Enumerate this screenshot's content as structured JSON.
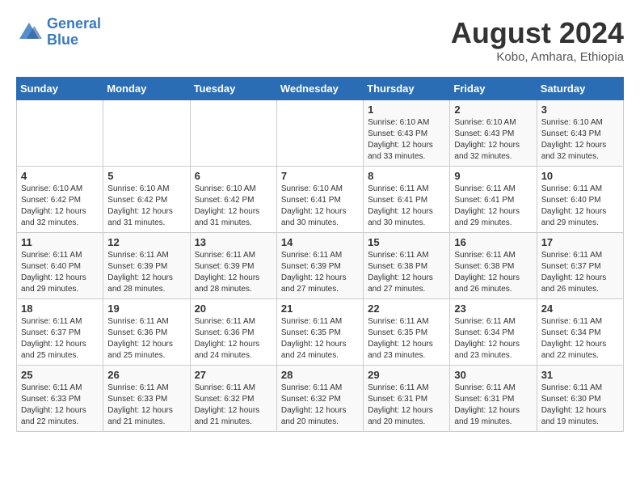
{
  "header": {
    "logo_line1": "General",
    "logo_line2": "Blue",
    "month": "August 2024",
    "location": "Kobo, Amhara, Ethiopia"
  },
  "days_of_week": [
    "Sunday",
    "Monday",
    "Tuesday",
    "Wednesday",
    "Thursday",
    "Friday",
    "Saturday"
  ],
  "weeks": [
    [
      {
        "day": "",
        "info": ""
      },
      {
        "day": "",
        "info": ""
      },
      {
        "day": "",
        "info": ""
      },
      {
        "day": "",
        "info": ""
      },
      {
        "day": "1",
        "info": "Sunrise: 6:10 AM\nSunset: 6:43 PM\nDaylight: 12 hours and 33 minutes."
      },
      {
        "day": "2",
        "info": "Sunrise: 6:10 AM\nSunset: 6:43 PM\nDaylight: 12 hours and 32 minutes."
      },
      {
        "day": "3",
        "info": "Sunrise: 6:10 AM\nSunset: 6:43 PM\nDaylight: 12 hours and 32 minutes."
      }
    ],
    [
      {
        "day": "4",
        "info": "Sunrise: 6:10 AM\nSunset: 6:42 PM\nDaylight: 12 hours and 32 minutes."
      },
      {
        "day": "5",
        "info": "Sunrise: 6:10 AM\nSunset: 6:42 PM\nDaylight: 12 hours and 31 minutes."
      },
      {
        "day": "6",
        "info": "Sunrise: 6:10 AM\nSunset: 6:42 PM\nDaylight: 12 hours and 31 minutes."
      },
      {
        "day": "7",
        "info": "Sunrise: 6:10 AM\nSunset: 6:41 PM\nDaylight: 12 hours and 30 minutes."
      },
      {
        "day": "8",
        "info": "Sunrise: 6:11 AM\nSunset: 6:41 PM\nDaylight: 12 hours and 30 minutes."
      },
      {
        "day": "9",
        "info": "Sunrise: 6:11 AM\nSunset: 6:41 PM\nDaylight: 12 hours and 29 minutes."
      },
      {
        "day": "10",
        "info": "Sunrise: 6:11 AM\nSunset: 6:40 PM\nDaylight: 12 hours and 29 minutes."
      }
    ],
    [
      {
        "day": "11",
        "info": "Sunrise: 6:11 AM\nSunset: 6:40 PM\nDaylight: 12 hours and 29 minutes."
      },
      {
        "day": "12",
        "info": "Sunrise: 6:11 AM\nSunset: 6:39 PM\nDaylight: 12 hours and 28 minutes."
      },
      {
        "day": "13",
        "info": "Sunrise: 6:11 AM\nSunset: 6:39 PM\nDaylight: 12 hours and 28 minutes."
      },
      {
        "day": "14",
        "info": "Sunrise: 6:11 AM\nSunset: 6:39 PM\nDaylight: 12 hours and 27 minutes."
      },
      {
        "day": "15",
        "info": "Sunrise: 6:11 AM\nSunset: 6:38 PM\nDaylight: 12 hours and 27 minutes."
      },
      {
        "day": "16",
        "info": "Sunrise: 6:11 AM\nSunset: 6:38 PM\nDaylight: 12 hours and 26 minutes."
      },
      {
        "day": "17",
        "info": "Sunrise: 6:11 AM\nSunset: 6:37 PM\nDaylight: 12 hours and 26 minutes."
      }
    ],
    [
      {
        "day": "18",
        "info": "Sunrise: 6:11 AM\nSunset: 6:37 PM\nDaylight: 12 hours and 25 minutes."
      },
      {
        "day": "19",
        "info": "Sunrise: 6:11 AM\nSunset: 6:36 PM\nDaylight: 12 hours and 25 minutes."
      },
      {
        "day": "20",
        "info": "Sunrise: 6:11 AM\nSunset: 6:36 PM\nDaylight: 12 hours and 24 minutes."
      },
      {
        "day": "21",
        "info": "Sunrise: 6:11 AM\nSunset: 6:35 PM\nDaylight: 12 hours and 24 minutes."
      },
      {
        "day": "22",
        "info": "Sunrise: 6:11 AM\nSunset: 6:35 PM\nDaylight: 12 hours and 23 minutes."
      },
      {
        "day": "23",
        "info": "Sunrise: 6:11 AM\nSunset: 6:34 PM\nDaylight: 12 hours and 23 minutes."
      },
      {
        "day": "24",
        "info": "Sunrise: 6:11 AM\nSunset: 6:34 PM\nDaylight: 12 hours and 22 minutes."
      }
    ],
    [
      {
        "day": "25",
        "info": "Sunrise: 6:11 AM\nSunset: 6:33 PM\nDaylight: 12 hours and 22 minutes."
      },
      {
        "day": "26",
        "info": "Sunrise: 6:11 AM\nSunset: 6:33 PM\nDaylight: 12 hours and 21 minutes."
      },
      {
        "day": "27",
        "info": "Sunrise: 6:11 AM\nSunset: 6:32 PM\nDaylight: 12 hours and 21 minutes."
      },
      {
        "day": "28",
        "info": "Sunrise: 6:11 AM\nSunset: 6:32 PM\nDaylight: 12 hours and 20 minutes."
      },
      {
        "day": "29",
        "info": "Sunrise: 6:11 AM\nSunset: 6:31 PM\nDaylight: 12 hours and 20 minutes."
      },
      {
        "day": "30",
        "info": "Sunrise: 6:11 AM\nSunset: 6:31 PM\nDaylight: 12 hours and 19 minutes."
      },
      {
        "day": "31",
        "info": "Sunrise: 6:11 AM\nSunset: 6:30 PM\nDaylight: 12 hours and 19 minutes."
      }
    ]
  ]
}
